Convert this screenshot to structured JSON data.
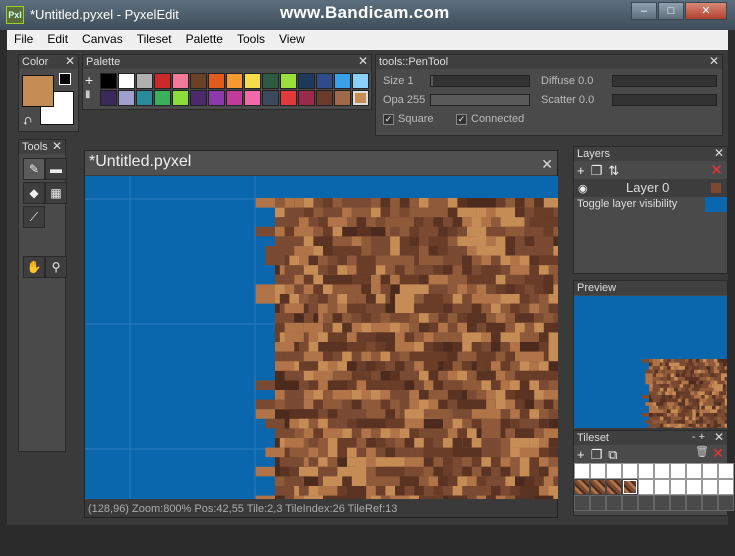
{
  "window": {
    "title": "*Untitled.pyxel - PyxelEdit",
    "watermark": "www.Bandicam.com",
    "app_icon_label": "Pxl",
    "controls": {
      "minimize": "–",
      "maximize": "□",
      "close": "✕"
    }
  },
  "menu": [
    "File",
    "Edit",
    "Canvas",
    "Tileset",
    "Palette",
    "Tools",
    "View"
  ],
  "color_panel": {
    "title": "Color",
    "primary": "#c68c56",
    "secondary": "#ffffff",
    "swap_icon": "swap-arrows-icon"
  },
  "palette_panel": {
    "title": "Palette",
    "add_icon": "+",
    "swatches": [
      "#000000",
      "#ffffff",
      "#b0b0b0",
      "#cc2a2a",
      "#f47a9a",
      "#6b4226",
      "#e25a1c",
      "#f49a2e",
      "#f7dc4a",
      "#2e5a44",
      "#9adf3a",
      "#1e3a5a",
      "#304a8a",
      "#39a0ea",
      "#8ad0f7",
      "#3a2a5a",
      "#a0a0d0",
      "#2a8a9a",
      "#3ab05a",
      "#8add3a",
      "#4a2a6a",
      "#8a3aaa",
      "#c23a9a",
      "#f06aaa",
      "#3a4a5a",
      "#e23a3a",
      "#9a2a4a",
      "#6a3a2a",
      "#a06a4a",
      "#c68c56"
    ],
    "selected_index": 29
  },
  "tool_options": {
    "title": "tools::PenTool",
    "size_label": "Size 1",
    "opacity_label": "Opa 255",
    "diffuse_label": "Diffuse 0.0",
    "scatter_label": "Scatter 0.0",
    "size_level": 0.02,
    "opacity_level": 1.0,
    "diffuse_level": 0.0,
    "scatter_level": 0.0,
    "square_label": "Square",
    "connected_label": "Connected",
    "square_checked": true,
    "connected_checked": true,
    "check_glyph": "✓"
  },
  "tools_panel": {
    "title": "Tools",
    "tools": [
      {
        "name": "pen-tool",
        "glyph": "✎",
        "active": true
      },
      {
        "name": "eraser-tool",
        "glyph": "▬",
        "active": false
      },
      {
        "name": "fill-tool",
        "glyph": "◆",
        "active": false
      },
      {
        "name": "select-tool",
        "glyph": "▦",
        "active": false
      },
      {
        "name": "eyedropper-tool",
        "glyph": "⟋",
        "active": false
      },
      {
        "name": "hand-tool",
        "glyph": "✋",
        "active": false
      },
      {
        "name": "zoom-tool",
        "glyph": "⚲",
        "active": false
      }
    ]
  },
  "document": {
    "title": "*Untitled.pyxel",
    "close": "✕",
    "status": "(128,96)  Zoom:800%  Pos:42,55  Tile:2,3  TileIndex:26  TileRef:13",
    "background_color": "#0a66ad"
  },
  "layers_panel": {
    "title": "Layers",
    "add_icon": "+",
    "duplicate_icon": "❐",
    "merge_icon": "⇅",
    "delete_icon": "✕",
    "layer_name": "Layer 0",
    "eye_icon": "◉",
    "tooltip": "Toggle layer visibility"
  },
  "preview_panel": {
    "title": "Preview"
  },
  "tileset_panel": {
    "title": "Tileset",
    "minmax": "- +",
    "add_icon": "+",
    "duplicate_icon": "❐",
    "link_icon": "⧉",
    "delete_icon": "✕",
    "trash_icon": "🗑"
  },
  "close_glyph": "✕"
}
